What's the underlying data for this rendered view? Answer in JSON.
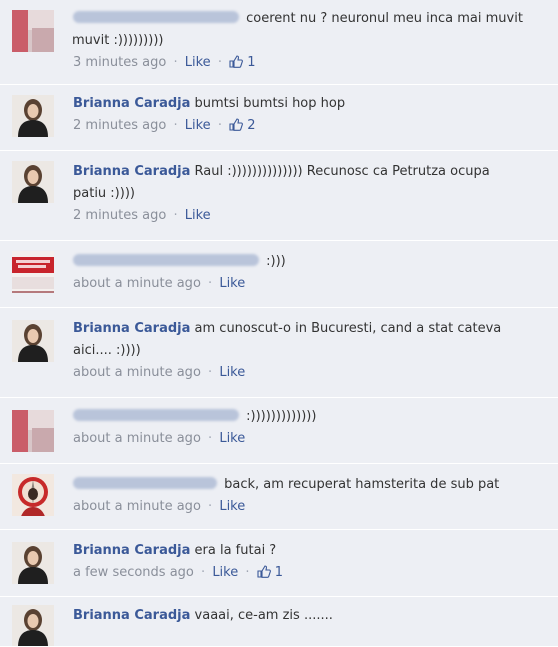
{
  "comments": [
    {
      "author": "",
      "text": "coerent nu ? neuronul meu inca mai muvit",
      "text2": "muvit :)))))))))",
      "time": "3 minutes ago",
      "like_label": "Like",
      "likes": "1",
      "avatar": "blur-red"
    },
    {
      "author": "Brianna Caradja",
      "text": "bumtsi bumtsi hop hop",
      "text2": "",
      "time": "2 minutes ago",
      "like_label": "Like",
      "likes": "2",
      "avatar": "woman-photo"
    },
    {
      "author": "Brianna Caradja",
      "text": "Raul :)))))))))))))) Recunosc ca Petrutza ocupa",
      "text2": "patiu :))))",
      "time": "2 minutes ago",
      "like_label": "Like",
      "likes": "",
      "avatar": "woman-photo"
    },
    {
      "author": "",
      "text": ":)))",
      "text2": "",
      "time": "about a minute ago",
      "like_label": "Like",
      "likes": "",
      "avatar": "red-logo"
    },
    {
      "author": "Brianna Caradja",
      "text": "am cunoscut-o in Bucuresti, cand a stat cateva",
      "text2": "aici.... :))))",
      "time": "about a minute ago",
      "like_label": "Like",
      "likes": "",
      "avatar": "woman-photo"
    },
    {
      "author": "",
      "text": ":)))))))))))))",
      "text2": "",
      "time": "about a minute ago",
      "like_label": "Like",
      "likes": "",
      "avatar": "blur-red"
    },
    {
      "author": "",
      "text": "back, am recuperat hamsterita de sub pat",
      "text2": "",
      "time": "about a minute ago",
      "like_label": "Like",
      "likes": "",
      "avatar": "colorful"
    },
    {
      "author": "Brianna Caradja",
      "text": "era la futai ?",
      "text2": "",
      "time": "a few seconds ago",
      "like_label": "Like",
      "likes": "1",
      "avatar": "woman-photo"
    },
    {
      "author": "Brianna Caradja",
      "text": "vaaai, ce-am zis .......",
      "text2": "",
      "time": "",
      "like_label": "",
      "likes": "",
      "avatar": "woman-photo"
    }
  ]
}
